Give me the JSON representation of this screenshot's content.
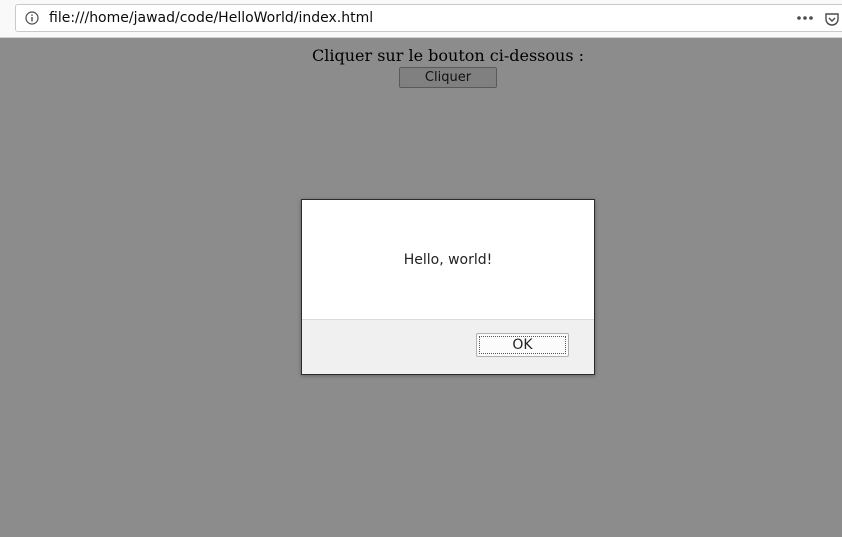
{
  "browser": {
    "url": "file:///home/jawad/code/HelloWorld/index.html",
    "icons": {
      "info": "info-icon",
      "more": "more-options-icon",
      "pocket": "pocket-icon"
    }
  },
  "page": {
    "prompt_text": "Cliquer sur le bouton ci-dessous :",
    "button_label": "Cliquer"
  },
  "dialog": {
    "message": "Hello, world!",
    "ok_label": "OK"
  },
  "colors": {
    "overlay": "#8a8a8a",
    "dialog_footer": "#f0f0f0"
  }
}
